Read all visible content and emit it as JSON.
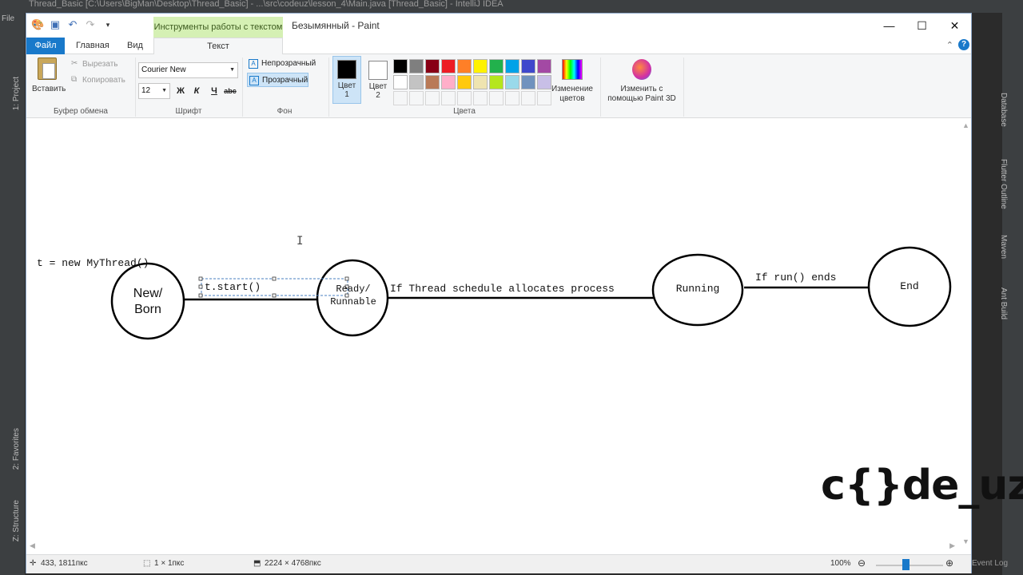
{
  "ide": {
    "title_bar": "Thread_Basic [C:\\Users\\BigMan\\Desktop\\Thread_Basic] - ...\\src\\codeuz\\lesson_4\\Main.java [Thread_Basic] - IntelliJ IDEA",
    "menu_file": "File",
    "left_panels": [
      "1: Project",
      "2: Favorites",
      "Z: Structure"
    ],
    "right_panels": [
      "Database",
      "Flutter Outline",
      "Maven",
      "Ant Build"
    ],
    "event_log": "Event Log"
  },
  "paint": {
    "window_title": "Безымянный - Paint",
    "context_tab": "Инструменты работы с текстом",
    "tabs": {
      "file": "Файл",
      "home": "Главная",
      "view": "Вид",
      "text": "Текст"
    },
    "clipboard": {
      "paste": "Вставить",
      "cut": "Вырезать",
      "copy": "Копировать",
      "group": "Буфер обмена"
    },
    "font": {
      "family": "Courier New",
      "size": "12",
      "bold": "Ж",
      "italic": "К",
      "underline": "Ч",
      "strike": "abc",
      "group": "Шрифт"
    },
    "background": {
      "opaque": "Непрозрачный",
      "transparent": "Прозрачный",
      "group": "Фон"
    },
    "colors": {
      "color1_label": "Цвет\n1",
      "color1": "#000000",
      "color2_label": "Цвет\n2",
      "color2": "#ffffff",
      "edit_colors": "Изменение цветов",
      "paint3d": "Изменить с помощью Paint 3D",
      "group": "Цвета",
      "palette_row1": [
        "#000000",
        "#7f7f7f",
        "#880015",
        "#ed1c24",
        "#ff7f27",
        "#fff200",
        "#22b14c",
        "#00a2e8",
        "#3f48cc",
        "#a349a4"
      ],
      "palette_row2": [
        "#ffffff",
        "#c3c3c3",
        "#b97a57",
        "#ffaec9",
        "#ffc90e",
        "#efe4b0",
        "#b5e61d",
        "#99d9ea",
        "#7092be",
        "#c8bfe7"
      ]
    },
    "status": {
      "cursor_pos": "433, 1811пкс",
      "selection_size": "1 × 1пкс",
      "canvas_size": "2224 × 4768пкс",
      "zoom": "100%"
    }
  },
  "diagram": {
    "code_line": "t = new MyThread()",
    "states": {
      "new_born": "New/\nBorn",
      "ready": "Ready/\nRunnable",
      "running": "Running",
      "end": "End"
    },
    "transitions": {
      "start": "t.start()",
      "schedule": "If Thread schedule allocates process",
      "ends": "If run() ends"
    }
  },
  "logo": "c{}de_uz"
}
